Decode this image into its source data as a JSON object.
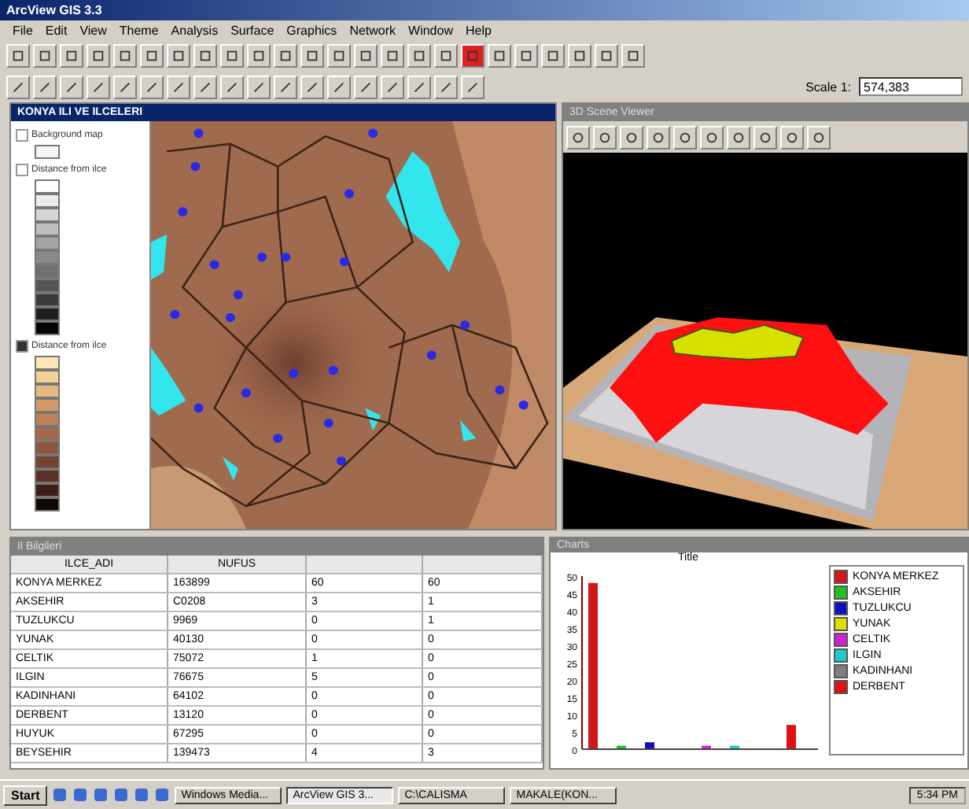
{
  "window": {
    "title": "ArcView GIS 3.3"
  },
  "menu": [
    "File",
    "Edit",
    "View",
    "Theme",
    "Analysis",
    "Surface",
    "Graphics",
    "Network",
    "Window",
    "Help"
  ],
  "toolbar": {
    "scale_label": "Scale 1:",
    "scale_value": "574,383"
  },
  "view": {
    "title": "KONYA ILI VE ILCELERI",
    "themes": [
      {
        "name": "Background map",
        "checked": false,
        "items": [
          {
            "color": "#f4f4f4"
          }
        ]
      },
      {
        "name": "Distance from ilce",
        "checked": false,
        "items": [
          {
            "color": "#ffffff"
          },
          {
            "color": "#ececec"
          },
          {
            "color": "#d6d6d6"
          },
          {
            "color": "#bdbdbd"
          },
          {
            "color": "#a4a4a4"
          },
          {
            "color": "#8a8a8a"
          },
          {
            "color": "#707070"
          },
          {
            "color": "#555555"
          },
          {
            "color": "#3a3a3a"
          },
          {
            "color": "#1f1f1f"
          },
          {
            "color": "#050505"
          }
        ]
      },
      {
        "name": "Distance from ilce",
        "checked": true,
        "items": [
          {
            "color": "#fbe7b5"
          },
          {
            "color": "#f2d096"
          },
          {
            "color": "#e6b97e"
          },
          {
            "color": "#d49a68"
          },
          {
            "color": "#be8058"
          },
          {
            "color": "#a66a4a"
          },
          {
            "color": "#8d563e"
          },
          {
            "color": "#744232"
          },
          {
            "color": "#5b3026"
          },
          {
            "color": "#3f1e18"
          },
          {
            "color": "#120806"
          }
        ]
      }
    ]
  },
  "scene": {
    "title": "3D Scene Viewer"
  },
  "table": {
    "title": "Il Bilgileri",
    "columns": [
      "ILCE_ADI",
      "NUFUS"
    ],
    "rows": [
      [
        "KONYA MERKEZ",
        "163899",
        "60",
        "60"
      ],
      [
        "AKSEHIR",
        "C0208",
        "3",
        "1"
      ],
      [
        "TUZLUKCU",
        "9969",
        "0",
        "1"
      ],
      [
        "YUNAK",
        "40130",
        "0",
        "0"
      ],
      [
        "CELTIK",
        "75072",
        "1",
        "0"
      ],
      [
        "ILGIN",
        "76675",
        "5",
        "0"
      ],
      [
        "KADINHANI",
        "64102",
        "0",
        "0"
      ],
      [
        "DERBENT",
        "13120",
        "0",
        "0"
      ],
      [
        "HUYUK",
        "67295",
        "0",
        "0"
      ],
      [
        "BEYSEHIR",
        "139473",
        "4",
        "3"
      ]
    ]
  },
  "chart": {
    "title": "Charts",
    "chart_data": {
      "type": "bar",
      "title": "Title",
      "ylim": [
        0,
        50
      ],
      "yticks": [
        0,
        5,
        10,
        15,
        20,
        25,
        30,
        35,
        40,
        45,
        50
      ],
      "series": [
        {
          "name": "KONYA MERKEZ",
          "color": "#d01818",
          "values": [
            48
          ]
        },
        {
          "name": "AKSEHIR",
          "color": "#20c020",
          "values": [
            1
          ]
        },
        {
          "name": "TUZLUKCU",
          "color": "#1010c0",
          "values": [
            2
          ]
        },
        {
          "name": "YUNAK",
          "color": "#e0e000",
          "values": [
            0
          ]
        },
        {
          "name": "CELTIK",
          "color": "#d020d0",
          "values": [
            1
          ]
        },
        {
          "name": "ILGIN",
          "color": "#20c8c8",
          "values": [
            1
          ]
        },
        {
          "name": "KADINHANI",
          "color": "#808080",
          "values": [
            0
          ]
        },
        {
          "name": "DERBENT",
          "color": "#e01010",
          "values": [
            7
          ]
        }
      ]
    }
  },
  "taskbar": {
    "start": "Start",
    "tasks": [
      {
        "label": "Windows Media...",
        "selected": false
      },
      {
        "label": "ArcView GIS 3...",
        "selected": true
      },
      {
        "label": "C:\\CALISMA",
        "selected": false
      },
      {
        "label": "MAKALE(KON...",
        "selected": false
      }
    ],
    "clock": "5:34 PM"
  }
}
